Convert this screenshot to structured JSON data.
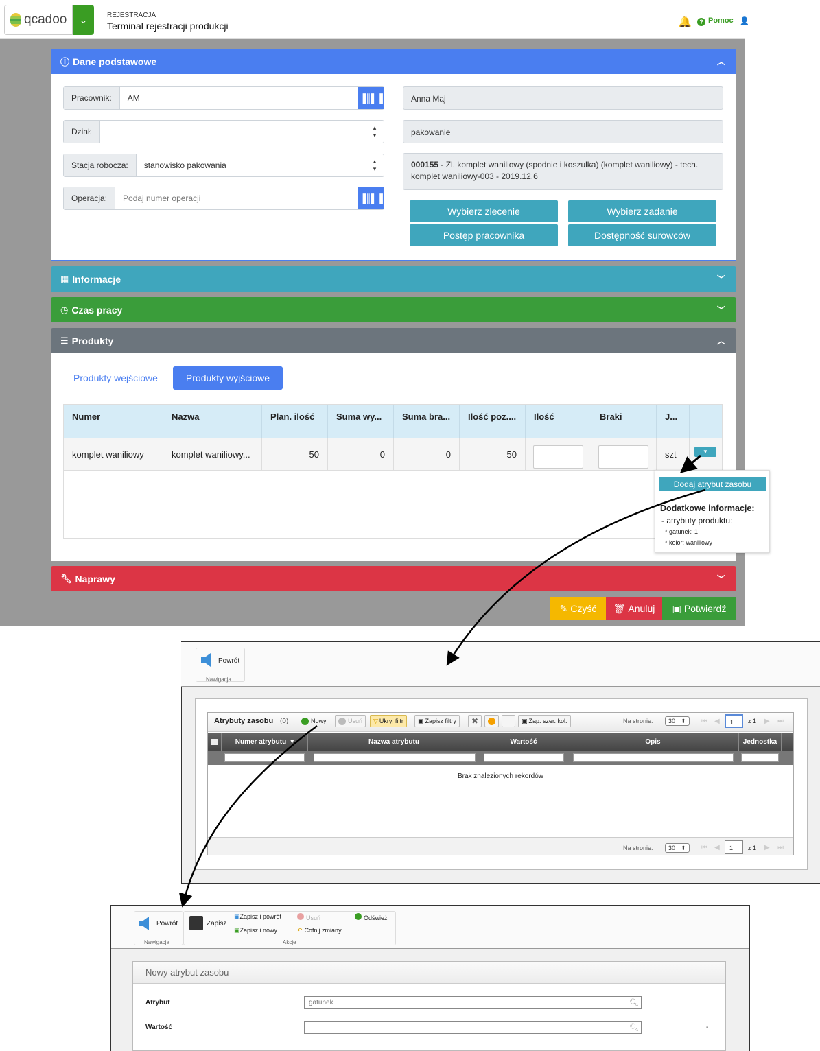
{
  "header": {
    "logo_text": "qcadoo",
    "breadcrumb_section": "REJESTRACJA",
    "breadcrumb_title": "Terminal rejestracji produkcji",
    "help_label": "Pomoc",
    "help_icon_text": "?"
  },
  "panels": {
    "basic": "Dane podstawowe",
    "info": "Informacje",
    "work_time": "Czas pracy",
    "products": "Produkty",
    "repairs": "Naprawy"
  },
  "basic_form": {
    "worker_label": "Pracownik:",
    "worker_value": "AM",
    "division_label": "Dział:",
    "division_value": "",
    "workstation_label": "Stacja robocza:",
    "workstation_value": "stanowisko pakowania",
    "operation_label": "Operacja:",
    "operation_placeholder": "Podaj numer operacji",
    "worker_name": "Anna Maj",
    "division_name": "pakowanie",
    "order_number": "000155",
    "order_desc": " - Zl. komplet waniliowy (spodnie i koszulka) (komplet waniliowy) - tech. komplet waniliowy-003 - 2019.12.6"
  },
  "terminal_buttons": {
    "select_order": "Wybierz zlecenie",
    "select_task": "Wybierz zadanie",
    "worker_progress": "Postęp pracownika",
    "material_availability": "Dostępność surowców"
  },
  "product_tabs": {
    "inputs": "Produkty wejściowe",
    "outputs": "Produkty wyjściowe"
  },
  "product_table": {
    "headers": [
      "Numer",
      "Nazwa",
      "Plan. ilość",
      "Suma wy...",
      "Suma bra...",
      "Ilość poz....",
      "Ilość",
      "Braki",
      "J..."
    ],
    "row": {
      "number": "komplet waniliowy",
      "name": "komplet waniliowy...",
      "planned": "50",
      "sum_produced": "0",
      "sum_waste": "0",
      "remaining": "50",
      "unit": "szt"
    }
  },
  "row_menu": {
    "add_attribute": "Dodaj atrybut zasobu",
    "extra_info_title": "Dodatkowe informacje:",
    "attributes_line": "- atrybuty produktu:",
    "attr_1": "* gatunek: 1",
    "attr_2": "* kolor: waniliowy"
  },
  "action_buttons": {
    "clear": "Czyść",
    "cancel": "Anuluj",
    "confirm": "Potwierdź"
  },
  "grid_view": {
    "back": "Powrót",
    "nav_group": "Nawigacja",
    "title": "Atrybuty zasobu",
    "count": "(0)",
    "new": "Nowy",
    "delete": "Usuń",
    "hide_filter": "Ukryj filtr",
    "save_filters": "Zapisz filtry",
    "save_col_widths": "Zap. szer. kol.",
    "per_page_label": "Na stronie:",
    "per_page_value": "30",
    "page_value": "1",
    "page_total": "z 1",
    "columns": [
      "Numer atrybutu",
      "Nazwa atrybutu",
      "Wartość",
      "Opis",
      "Jednostka"
    ],
    "empty": "Brak znalezionych rekordów"
  },
  "form_view": {
    "back": "Powrót",
    "save": "Zapisz",
    "save_back": "Zapisz i powrót",
    "save_new": "Zapisz i nowy",
    "delete": "Usuń",
    "undo": "Cofnij zmiany",
    "refresh": "Odśwież",
    "nav_group": "Nawigacja",
    "actions_group": "Akcje",
    "title": "Nowy atrybut zasobu",
    "attribute_label": "Atrybut",
    "attribute_value": "gatunek",
    "value_label": "Wartość",
    "value_value": "",
    "unit_value": "-"
  },
  "colors": {
    "primary": "#4a7ef0",
    "info": "#3fa6bd",
    "success": "#3a9d3a",
    "secondary": "#6c757d",
    "danger": "#dc3545",
    "warning": "#f5b800",
    "brand_green": "#3a9d23"
  }
}
